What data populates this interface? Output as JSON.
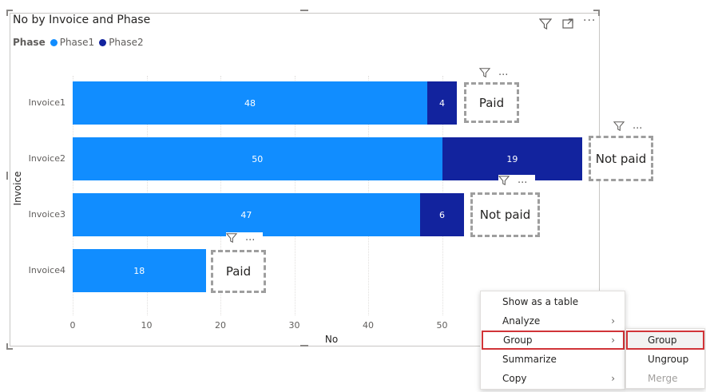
{
  "visual": {
    "title": "No by Invoice and Phase",
    "filter_icon": "filter-icon",
    "focus_icon": "focus-mode-icon",
    "more_icon": "more-options-icon",
    "more_glyph": "···"
  },
  "legend": {
    "title": "Phase",
    "items": [
      {
        "label": "Phase1",
        "color": "#118dff"
      },
      {
        "label": "Phase2",
        "color": "#12239e"
      }
    ]
  },
  "chart_data": {
    "type": "bar",
    "orientation": "horizontal",
    "stacked": true,
    "categories": [
      "Invoice1",
      "Invoice2",
      "Invoice3",
      "Invoice4"
    ],
    "series": [
      {
        "name": "Phase1",
        "color": "#118dff",
        "values": [
          48,
          50,
          47,
          18
        ]
      },
      {
        "name": "Phase2",
        "color": "#12239e",
        "values": [
          4,
          19,
          6,
          0
        ]
      }
    ],
    "xlabel": "No",
    "ylabel": "Invoice",
    "xlim": [
      0,
      69.2
    ],
    "xticks": [
      "0",
      "10",
      "20",
      "30",
      "40",
      "50"
    ],
    "grid": true
  },
  "status_labels": [
    "Paid",
    "Not paid",
    "Not paid",
    "Paid"
  ],
  "context_menu": {
    "items": [
      {
        "label": "Show as a table",
        "has_submenu": false
      },
      {
        "label": "Analyze",
        "has_submenu": true
      },
      {
        "label": "Group",
        "has_submenu": true,
        "highlighted": true
      },
      {
        "label": "Summarize",
        "has_submenu": false
      },
      {
        "label": "Copy",
        "has_submenu": true
      }
    ]
  },
  "submenu": {
    "items": [
      {
        "label": "Group",
        "highlighted": true,
        "disabled": false
      },
      {
        "label": "Ungroup",
        "highlighted": false,
        "disabled": false
      },
      {
        "label": "Merge",
        "highlighted": false,
        "disabled": true
      }
    ]
  }
}
